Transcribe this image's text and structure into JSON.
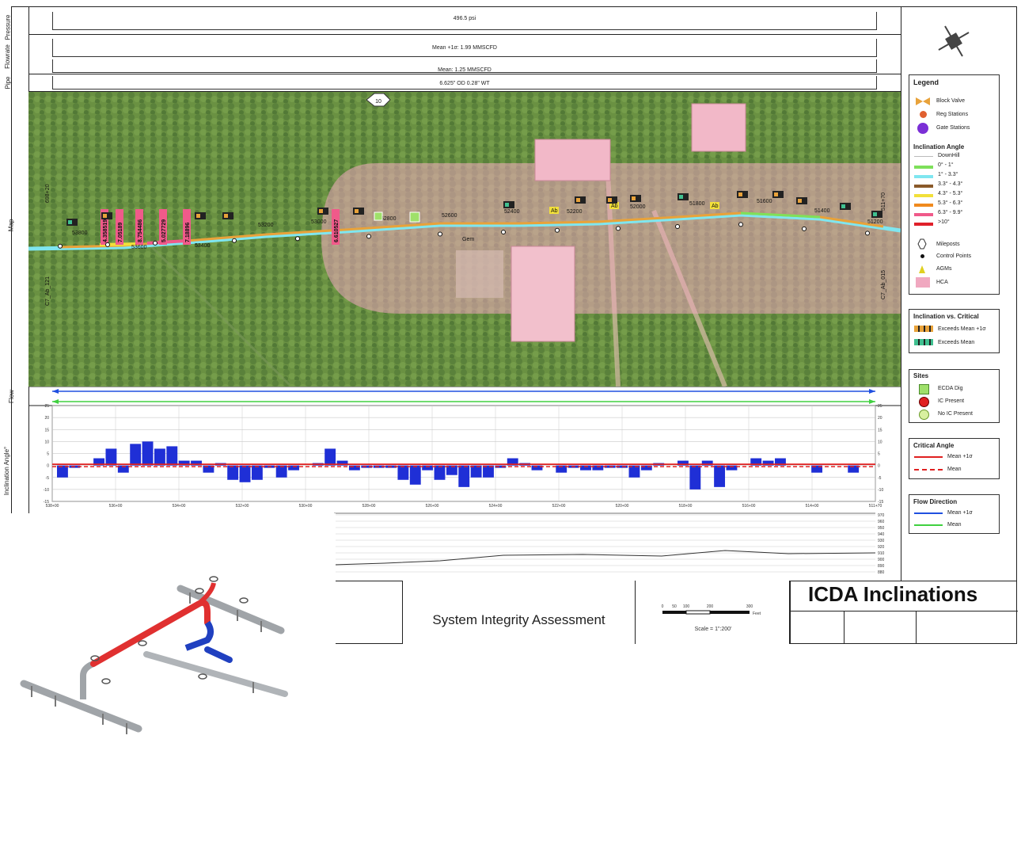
{
  "header": {
    "pressure_label": "Pressure",
    "flowrate_label": "Flowrate",
    "pipe_label": "Pipe",
    "map_label": "Map",
    "flow_label": "Flow",
    "inclination_label": "Inclination Angle°",
    "pressure_value": "496.5 psi",
    "flow_mean_sigma": "Mean +1σ: 1.99 MMSCFD",
    "flow_mean": "Mean: 1.25 MMSCFD",
    "pipe_value": "6.625\" OD 0.28\" WT"
  },
  "map": {
    "milepost": "10",
    "left_label_top": "698+20",
    "left_label_bottom": "C7_Ab_121",
    "right_label_top": "511+70",
    "right_label_bottom": "C7_Ab_015",
    "gas_label": "Gem",
    "stations": [
      "53800",
      "53600",
      "53400",
      "53200",
      "53000",
      "52800",
      "52600",
      "52400",
      "52200",
      "52000",
      "51800",
      "51600",
      "51400",
      "51200"
    ],
    "ab_labels": [
      "Ab",
      "Ab",
      "Ab"
    ],
    "magenta_tags": [
      "4.358519",
      "7.05189",
      "8.754486",
      "5.027729",
      "7.18896",
      "6.610527"
    ]
  },
  "chart_data": {
    "type": "bar",
    "title": "",
    "xlabel": "",
    "ylabel": "Inclination Angle°",
    "ylim": [
      -15,
      25
    ],
    "yticks": [
      "25",
      "20",
      "15",
      "10",
      "5",
      "0",
      "-5",
      "-10",
      "-15"
    ],
    "mean_plus_sigma": 0.5,
    "mean": -0.5,
    "xtick_labels": [
      "538+00",
      "536+00",
      "534+00",
      "532+00",
      "530+00",
      "528+00",
      "526+00",
      "524+00",
      "522+00",
      "520+00",
      "518+00",
      "516+00",
      "514+00",
      "511+70"
    ],
    "values": [
      -5,
      -1,
      0,
      3,
      7,
      -3,
      9,
      10,
      7,
      8,
      2,
      2,
      -3,
      1,
      -6,
      -7,
      -6,
      -1,
      -5,
      -2,
      0,
      1,
      7,
      2,
      -2,
      -1,
      -1,
      -1,
      -6,
      -8,
      -2,
      -6,
      -4,
      -9,
      -5,
      -5,
      -1,
      3,
      1,
      -2,
      0,
      -3,
      -1,
      -2,
      -2,
      -1,
      -1,
      -5,
      -2,
      1,
      0,
      2,
      -10,
      2,
      -9,
      -2,
      0,
      3,
      2,
      3,
      0,
      0,
      -3,
      0,
      0,
      -3,
      0
    ],
    "elevation_ticks": [
      "970",
      "960",
      "950",
      "940",
      "930",
      "920",
      "910",
      "900",
      "890",
      "880"
    ]
  },
  "legend": {
    "title": "Legend",
    "items": [
      "Block Valve",
      "Reg Stations",
      "Gate Stations"
    ],
    "incl_title": "Inclination Angle",
    "incl_items": [
      "DownHill",
      "0° - 1°",
      "1° - 3.3°",
      "3.3° - 4.3°",
      "4.3° - 5.3°",
      "5.3° - 6.3°",
      "6.3° - 9.9°",
      ">10°"
    ],
    "incl_colors": [
      "#ffffff",
      "#7ee05a",
      "#7fe6f0",
      "#8a5a2a",
      "#f2e03a",
      "#f08a1e",
      "#f05a8a",
      "#e0202a"
    ],
    "other_items": [
      "Mileposts",
      "Control Points",
      "AGMs",
      "HCA"
    ],
    "incl_vs_title": "Inclination vs. Critical",
    "incl_vs_items": [
      "Exceeds Mean +1σ",
      "Exceeds Mean"
    ],
    "sites_title": "Sites",
    "sites_items": [
      "ECDA Dig",
      "IC Present",
      "No IC Present"
    ],
    "crit_title": "Critical Angle",
    "crit_items": [
      "Mean +1σ",
      "Mean"
    ],
    "flow_title": "Flow Direction",
    "flow_items": [
      "Mean +1σ",
      "Mean"
    ]
  },
  "title_block": {
    "subtitle": "System Integrity Assessment",
    "title": "ICDA Inclinations",
    "scale_ticks": [
      "0",
      "50",
      "100",
      "200",
      "300"
    ],
    "scale_unit": "Feet",
    "scale_text": "Scale = 1\":200'"
  },
  "colors": {
    "pipeline_orange": "#e8a23a",
    "bar_blue": "#1f2fd6",
    "critical_red": "#e02020",
    "flow_blue": "#2050e0",
    "flow_green": "#40d040",
    "hca_pink": "#f0a8c0",
    "pipe_red": "#e03030",
    "pipe_blue": "#2040c0"
  }
}
